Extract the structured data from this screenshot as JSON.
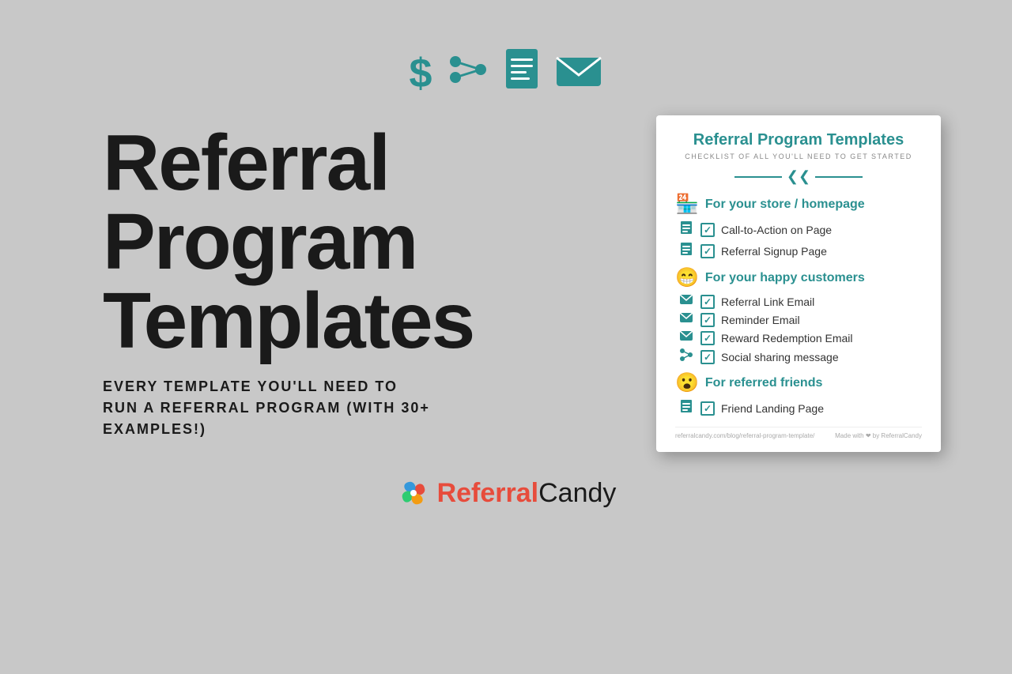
{
  "icons": {
    "dollar": "$",
    "share": "⋰",
    "doc": "📄",
    "mail": "✉"
  },
  "main_title_line1": "Referral",
  "main_title_line2": "Program",
  "main_title_line3": "Templates",
  "subtitle": "EVERY TEMPLATE YOU'LL NEED TO RUN A REFERRAL PROGRAM (WITH 30+ EXAMPLES!)",
  "card": {
    "title": "Referral Program Templates",
    "subtitle": "CHECKLIST OF ALL YOU'LL NEED TO GET STARTED",
    "sections": [
      {
        "emoji": "🏪",
        "title": "For your store / homepage",
        "items": [
          {
            "icon": "📄",
            "checked": true,
            "text": "Call-to-Action on Page"
          },
          {
            "icon": "📄",
            "checked": true,
            "text": "Referral Signup Page"
          }
        ]
      },
      {
        "emoji": "😁",
        "title": "For your happy customers",
        "items": [
          {
            "icon": "✉",
            "checked": true,
            "text": "Referral Link Email"
          },
          {
            "icon": "✉",
            "checked": true,
            "text": "Reminder Email"
          },
          {
            "icon": "✉",
            "checked": true,
            "text": "Reward Redemption Email"
          },
          {
            "icon": "⋰",
            "checked": true,
            "text": "Social sharing message"
          }
        ]
      },
      {
        "emoji": "😮",
        "title": "For referred friends",
        "items": [
          {
            "icon": "📄",
            "checked": true,
            "text": "Friend Landing Page"
          }
        ]
      }
    ],
    "footer_url": "referralcandy.com/blog/referral-program-template/",
    "footer_made_with": "Made with ❤ by ReferralCandy"
  },
  "logo": {
    "text_referral": "Referral",
    "text_candy": "Candy"
  }
}
